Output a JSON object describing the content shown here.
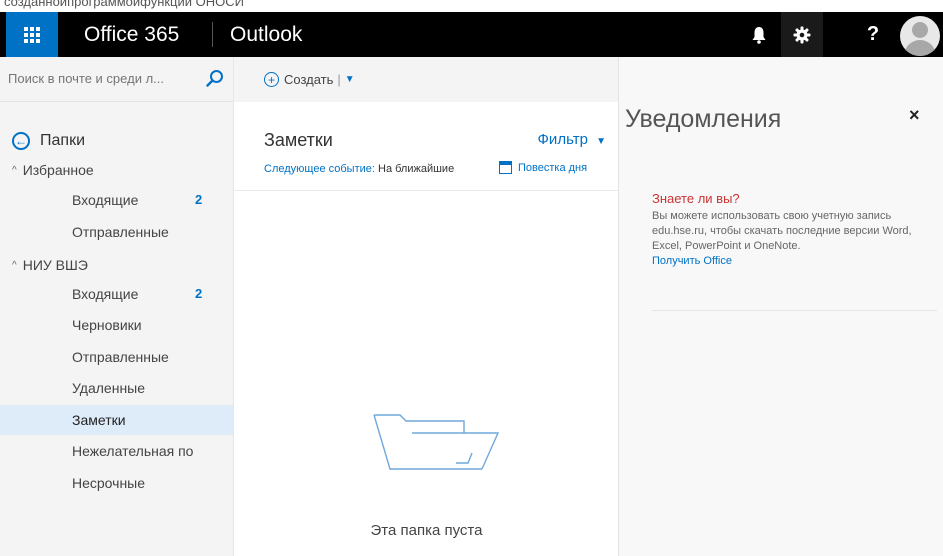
{
  "header": {
    "brand": "Office 365",
    "app_name": "Outlook",
    "help_glyph": "?",
    "icons": [
      "app-launcher-icon",
      "bell-icon",
      "gear-icon",
      "help-icon",
      "avatar"
    ],
    "colors": {
      "bar": "#000000",
      "launcher": "#0072c6",
      "accent": "#0072c6"
    }
  },
  "top_strip_text": "созданнойпрограммойфункции ОНОСИ",
  "search": {
    "placeholder": "Поиск в почте и среди л..."
  },
  "toolbar": {
    "new_label": "Создать",
    "new_separator": "|"
  },
  "nav": {
    "folders_label": "Папки",
    "favorites": {
      "label": "Избранное",
      "items": [
        {
          "label": "Входящие",
          "count": "2"
        },
        {
          "label": "Отправленные",
          "count": ""
        }
      ]
    },
    "account": {
      "label": "НИУ ВШЭ",
      "items": [
        {
          "label": "Входящие",
          "count": "2"
        },
        {
          "label": "Черновики",
          "count": ""
        },
        {
          "label": "Отправленные",
          "count": ""
        },
        {
          "label": "Удаленные",
          "count": ""
        },
        {
          "label": "Заметки",
          "count": "",
          "selected": true
        },
        {
          "label": "Нежелательная по",
          "count": ""
        },
        {
          "label": "Несрочные",
          "count": ""
        }
      ]
    }
  },
  "list": {
    "title": "Заметки",
    "filter_label": "Фильтр",
    "next_event_label": "Следующее событие:",
    "next_event_text": "На ближайшие",
    "agenda_label": "Повестка дня",
    "empty_text": "Эта папка пуста"
  },
  "notifications": {
    "title": "Уведомления",
    "close_glyph": "×",
    "card_title": "Знаете ли вы?",
    "card_body": "Вы можете использовать свою учетную запись edu.hse.ru, чтобы скачать последние версии Word, Excel, PowerPoint и OneNote.",
    "card_link": "Получить Office"
  }
}
